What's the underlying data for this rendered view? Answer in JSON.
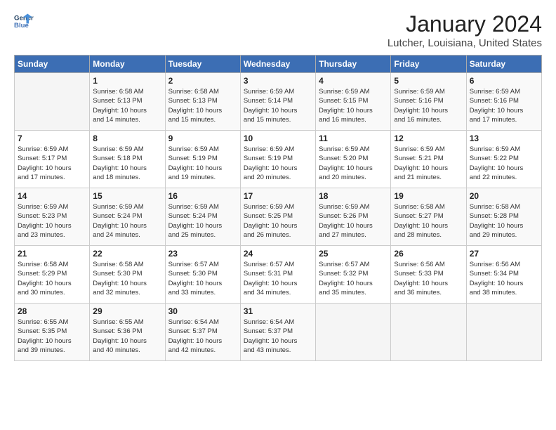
{
  "logo": {
    "line1": "General",
    "line2": "Blue"
  },
  "title": "January 2024",
  "subtitle": "Lutcher, Louisiana, United States",
  "days_of_week": [
    "Sunday",
    "Monday",
    "Tuesday",
    "Wednesday",
    "Thursday",
    "Friday",
    "Saturday"
  ],
  "weeks": [
    [
      {
        "day": "",
        "info": ""
      },
      {
        "day": "1",
        "info": "Sunrise: 6:58 AM\nSunset: 5:13 PM\nDaylight: 10 hours\nand 14 minutes."
      },
      {
        "day": "2",
        "info": "Sunrise: 6:58 AM\nSunset: 5:13 PM\nDaylight: 10 hours\nand 15 minutes."
      },
      {
        "day": "3",
        "info": "Sunrise: 6:59 AM\nSunset: 5:14 PM\nDaylight: 10 hours\nand 15 minutes."
      },
      {
        "day": "4",
        "info": "Sunrise: 6:59 AM\nSunset: 5:15 PM\nDaylight: 10 hours\nand 16 minutes."
      },
      {
        "day": "5",
        "info": "Sunrise: 6:59 AM\nSunset: 5:16 PM\nDaylight: 10 hours\nand 16 minutes."
      },
      {
        "day": "6",
        "info": "Sunrise: 6:59 AM\nSunset: 5:16 PM\nDaylight: 10 hours\nand 17 minutes."
      }
    ],
    [
      {
        "day": "7",
        "info": "Sunrise: 6:59 AM\nSunset: 5:17 PM\nDaylight: 10 hours\nand 17 minutes."
      },
      {
        "day": "8",
        "info": "Sunrise: 6:59 AM\nSunset: 5:18 PM\nDaylight: 10 hours\nand 18 minutes."
      },
      {
        "day": "9",
        "info": "Sunrise: 6:59 AM\nSunset: 5:19 PM\nDaylight: 10 hours\nand 19 minutes."
      },
      {
        "day": "10",
        "info": "Sunrise: 6:59 AM\nSunset: 5:19 PM\nDaylight: 10 hours\nand 20 minutes."
      },
      {
        "day": "11",
        "info": "Sunrise: 6:59 AM\nSunset: 5:20 PM\nDaylight: 10 hours\nand 20 minutes."
      },
      {
        "day": "12",
        "info": "Sunrise: 6:59 AM\nSunset: 5:21 PM\nDaylight: 10 hours\nand 21 minutes."
      },
      {
        "day": "13",
        "info": "Sunrise: 6:59 AM\nSunset: 5:22 PM\nDaylight: 10 hours\nand 22 minutes."
      }
    ],
    [
      {
        "day": "14",
        "info": "Sunrise: 6:59 AM\nSunset: 5:23 PM\nDaylight: 10 hours\nand 23 minutes."
      },
      {
        "day": "15",
        "info": "Sunrise: 6:59 AM\nSunset: 5:24 PM\nDaylight: 10 hours\nand 24 minutes."
      },
      {
        "day": "16",
        "info": "Sunrise: 6:59 AM\nSunset: 5:24 PM\nDaylight: 10 hours\nand 25 minutes."
      },
      {
        "day": "17",
        "info": "Sunrise: 6:59 AM\nSunset: 5:25 PM\nDaylight: 10 hours\nand 26 minutes."
      },
      {
        "day": "18",
        "info": "Sunrise: 6:59 AM\nSunset: 5:26 PM\nDaylight: 10 hours\nand 27 minutes."
      },
      {
        "day": "19",
        "info": "Sunrise: 6:58 AM\nSunset: 5:27 PM\nDaylight: 10 hours\nand 28 minutes."
      },
      {
        "day": "20",
        "info": "Sunrise: 6:58 AM\nSunset: 5:28 PM\nDaylight: 10 hours\nand 29 minutes."
      }
    ],
    [
      {
        "day": "21",
        "info": "Sunrise: 6:58 AM\nSunset: 5:29 PM\nDaylight: 10 hours\nand 30 minutes."
      },
      {
        "day": "22",
        "info": "Sunrise: 6:58 AM\nSunset: 5:30 PM\nDaylight: 10 hours\nand 32 minutes."
      },
      {
        "day": "23",
        "info": "Sunrise: 6:57 AM\nSunset: 5:30 PM\nDaylight: 10 hours\nand 33 minutes."
      },
      {
        "day": "24",
        "info": "Sunrise: 6:57 AM\nSunset: 5:31 PM\nDaylight: 10 hours\nand 34 minutes."
      },
      {
        "day": "25",
        "info": "Sunrise: 6:57 AM\nSunset: 5:32 PM\nDaylight: 10 hours\nand 35 minutes."
      },
      {
        "day": "26",
        "info": "Sunrise: 6:56 AM\nSunset: 5:33 PM\nDaylight: 10 hours\nand 36 minutes."
      },
      {
        "day": "27",
        "info": "Sunrise: 6:56 AM\nSunset: 5:34 PM\nDaylight: 10 hours\nand 38 minutes."
      }
    ],
    [
      {
        "day": "28",
        "info": "Sunrise: 6:55 AM\nSunset: 5:35 PM\nDaylight: 10 hours\nand 39 minutes."
      },
      {
        "day": "29",
        "info": "Sunrise: 6:55 AM\nSunset: 5:36 PM\nDaylight: 10 hours\nand 40 minutes."
      },
      {
        "day": "30",
        "info": "Sunrise: 6:54 AM\nSunset: 5:37 PM\nDaylight: 10 hours\nand 42 minutes."
      },
      {
        "day": "31",
        "info": "Sunrise: 6:54 AM\nSunset: 5:37 PM\nDaylight: 10 hours\nand 43 minutes."
      },
      {
        "day": "",
        "info": ""
      },
      {
        "day": "",
        "info": ""
      },
      {
        "day": "",
        "info": ""
      }
    ]
  ]
}
